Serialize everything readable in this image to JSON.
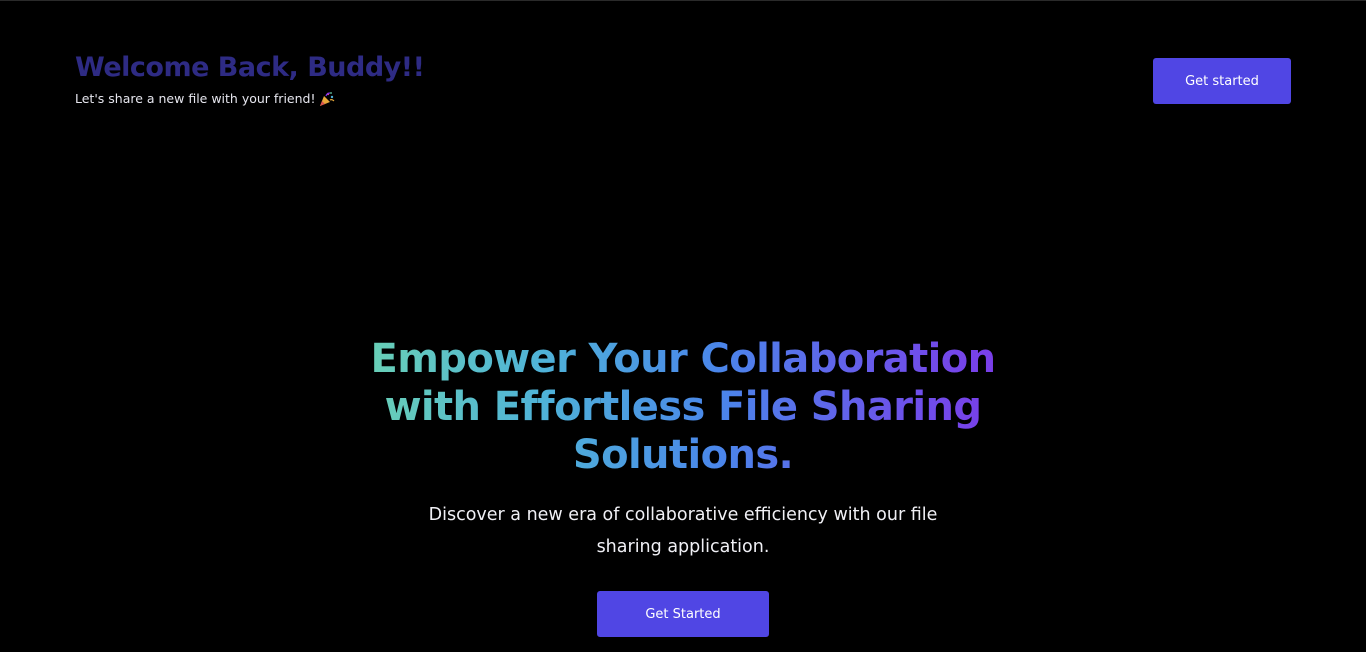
{
  "header": {
    "welcome_title": "Welcome Back, Buddy!!",
    "welcome_subtitle": "Let's share a new file with your friend!",
    "subtitle_icon": "party-popper-icon",
    "cta_label": "Get started"
  },
  "hero": {
    "title": "Empower Your Collaboration with Effortless File Sharing Solutions.",
    "description": "Discover a new era of collaborative efficiency with our file sharing application.",
    "cta_label": "Get Started"
  },
  "colors": {
    "background": "#000000",
    "welcome_title": "#2e2b84",
    "button": "#5046e4",
    "gradient": [
      "#6ed6b0",
      "#4fb2d8",
      "#4a86ea",
      "#6b55ea",
      "#7f35e8"
    ]
  }
}
